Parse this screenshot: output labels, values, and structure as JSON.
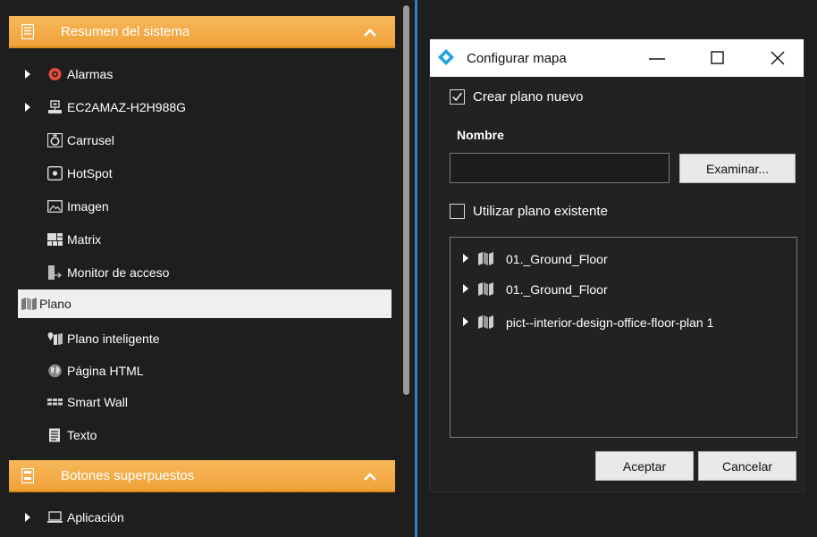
{
  "left_panel": {
    "system_section": {
      "title": "Resumen del sistema"
    },
    "overlay_section": {
      "title": "Botones superpuestos"
    },
    "items": [
      {
        "label": "Alarmas",
        "icon": "alarm-icon",
        "expandable": true
      },
      {
        "label": "EC2AMAZ-H2H988G",
        "icon": "server-icon",
        "expandable": true
      },
      {
        "label": "Carrusel",
        "icon": "carousel-icon",
        "expandable": false
      },
      {
        "label": "HotSpot",
        "icon": "hotspot-icon",
        "expandable": false
      },
      {
        "label": "Imagen",
        "icon": "image-icon",
        "expandable": false
      },
      {
        "label": "Matrix",
        "icon": "matrix-icon",
        "expandable": false
      },
      {
        "label": "Monitor de acceso",
        "icon": "access-monitor-icon",
        "expandable": false
      },
      {
        "label": "Plano",
        "icon": "map-icon",
        "expandable": false,
        "selected": true
      },
      {
        "label": "Plano inteligente",
        "icon": "smart-map-icon",
        "expandable": false
      },
      {
        "label": "Página HTML",
        "icon": "globe-icon",
        "expandable": false
      },
      {
        "label": "Smart Wall",
        "icon": "smart-wall-icon",
        "expandable": false
      },
      {
        "label": "Texto",
        "icon": "text-icon",
        "expandable": false
      }
    ],
    "overlay_items": [
      {
        "label": "Aplicación",
        "icon": "laptop-icon",
        "expandable": true
      }
    ]
  },
  "dialog": {
    "title": "Configurar mapa",
    "create_new_label": "Crear plano nuevo",
    "create_new_checked": true,
    "name_label": "Nombre",
    "name_value": "",
    "browse_label": "Examinar...",
    "use_existing_label": "Utilizar plano existente",
    "use_existing_checked": false,
    "plans": [
      {
        "label": "01._Ground_Floor"
      },
      {
        "label": "01._Ground_Floor"
      },
      {
        "label": "pict--interior-design-office-floor-plan 1"
      }
    ],
    "accept_label": "Aceptar",
    "cancel_label": "Cancelar"
  },
  "colors": {
    "header_orange": "#f0a23a",
    "divider_blue": "#2f7fc9",
    "alarm_red": "#e64c3c",
    "logo_blue": "#1fa3e0"
  }
}
